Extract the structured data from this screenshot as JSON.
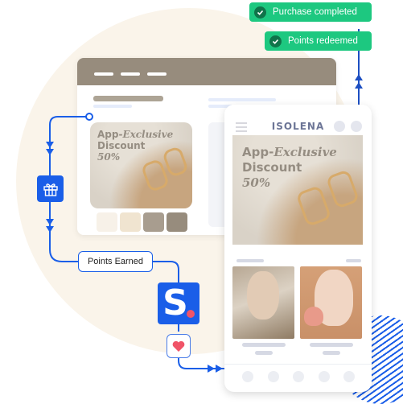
{
  "badges": {
    "purchase_completed": "Purchase completed",
    "points_redeemed": "Points redeemed"
  },
  "flow": {
    "points_earned_label": "Points Earned",
    "gift_icon": "gift-icon",
    "logo_letter": "S",
    "heart_icon": "heart-icon"
  },
  "desktop": {
    "promo": {
      "line1": "App-",
      "line1_italic": "Exclusive",
      "line2": "Discount",
      "line3": "50%"
    },
    "swatches": [
      "#f7f1e8",
      "#f0e4d0",
      "#a89d8f",
      "#978c7d"
    ]
  },
  "phone": {
    "brand": "ISOLENA",
    "promo": {
      "line1": "App-",
      "line1_italic": "Exclusive",
      "line2": "Discount",
      "line3": "50%"
    }
  },
  "colors": {
    "accent": "#1a5ee8",
    "success": "#1dc880",
    "header": "#978c7d",
    "heart": "#f05468"
  }
}
